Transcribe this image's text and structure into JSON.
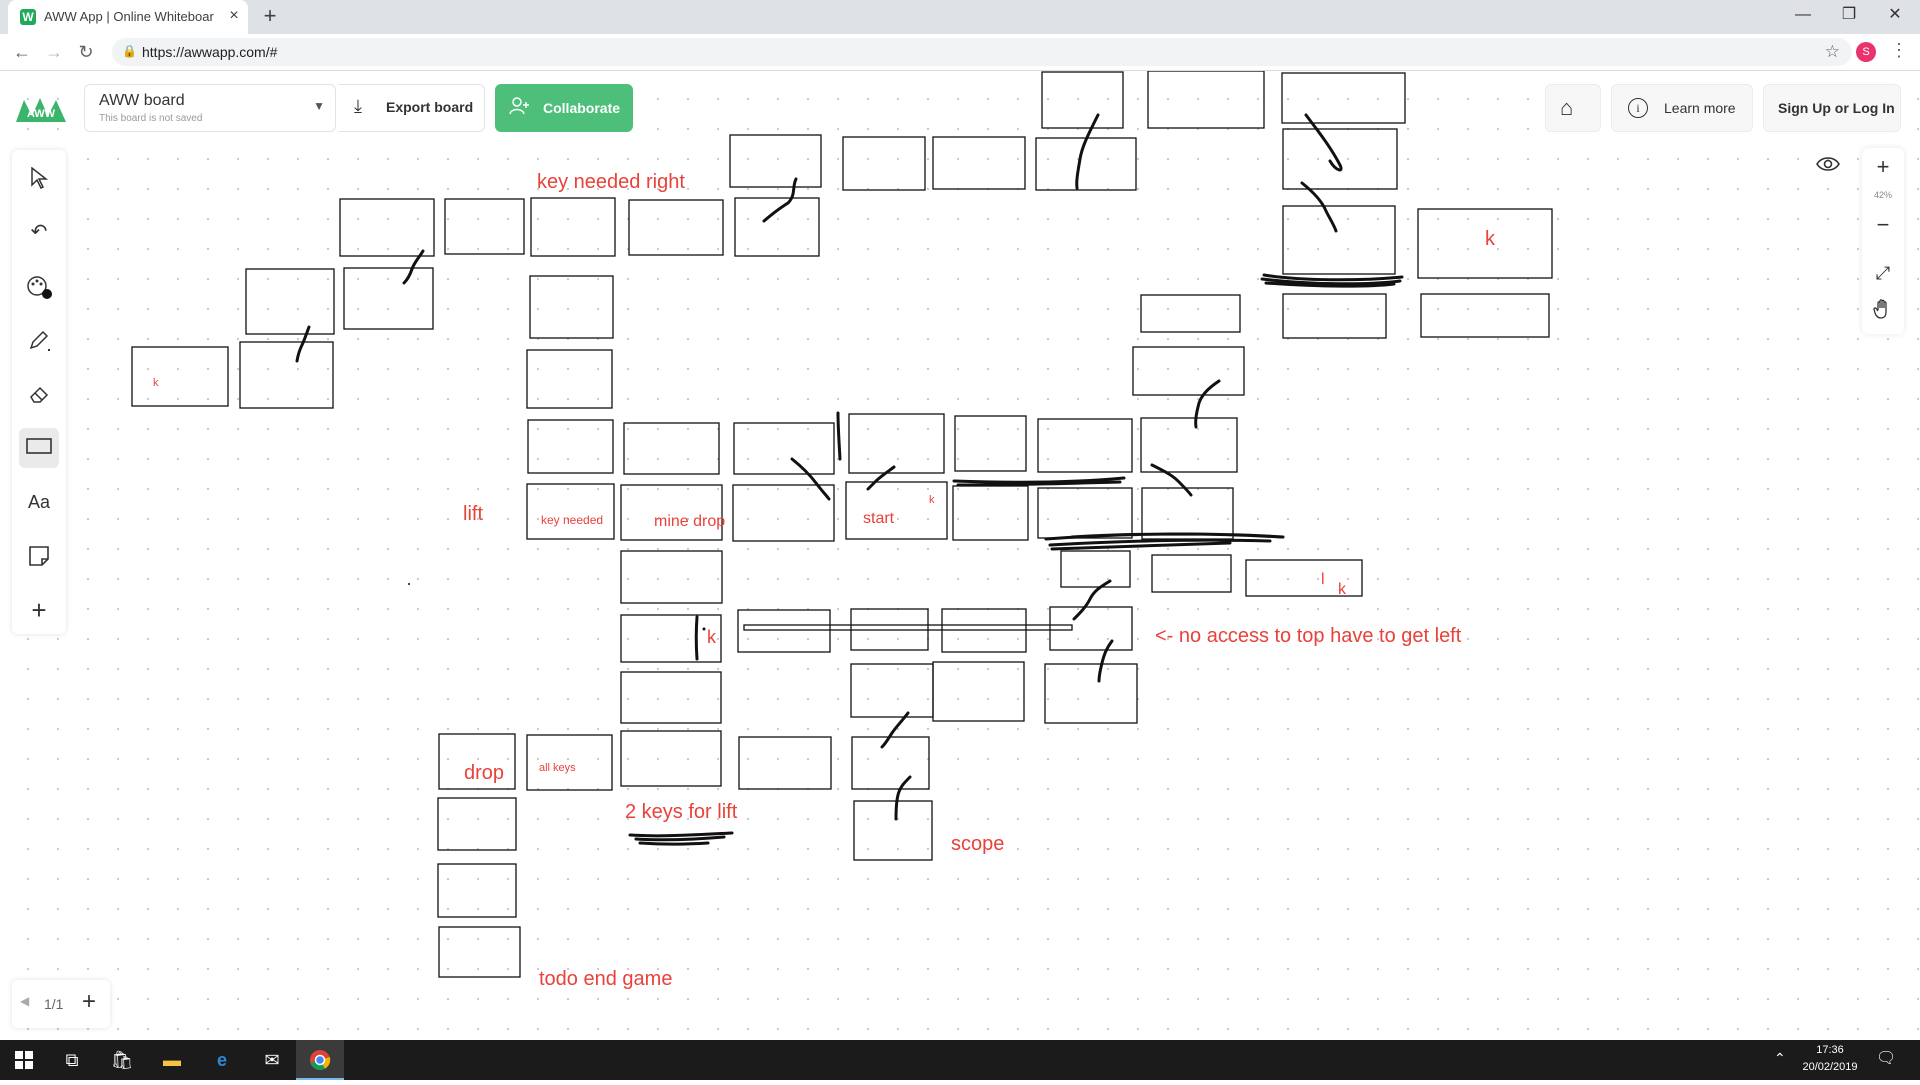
{
  "browser": {
    "tab_title": "AWW App | Online Whiteboard f",
    "tab_close": "×",
    "new_tab": "+",
    "url": "https://awwapp.com/#",
    "profile_initial": "S"
  },
  "header": {
    "logo_text": "AWW",
    "board_name": "AWW board",
    "board_status": "This board is not saved",
    "export_label": "Export board",
    "collaborate_label": "Collaborate",
    "learn_more_label": "Learn more",
    "signup_label": "Sign Up or Log In"
  },
  "toolbar": {
    "text_tool_label": "Aa",
    "add_label": "+"
  },
  "zoom": {
    "plus": "+",
    "level": "42%",
    "minus": "−"
  },
  "pages": {
    "indicator": "1/1",
    "add": "+"
  },
  "board_texts": {
    "key_needed_right": "key needed right",
    "lift": "lift",
    "key_needed": "key needed",
    "mine_drop": "mine drop",
    "start": "start",
    "k_start": "k",
    "k_left": "k",
    "k_top_right": "k",
    "k_middle": "k",
    "l_right": "l",
    "k_right": "k",
    "drop": "drop",
    "all_keys": "all keys",
    "two_keys": "2 keys for lift",
    "no_access": "<- no access to top have to get left",
    "scope": "scope",
    "todo": "todo end game"
  },
  "taskbar": {
    "time": "17:36",
    "date": "20/02/2019"
  }
}
